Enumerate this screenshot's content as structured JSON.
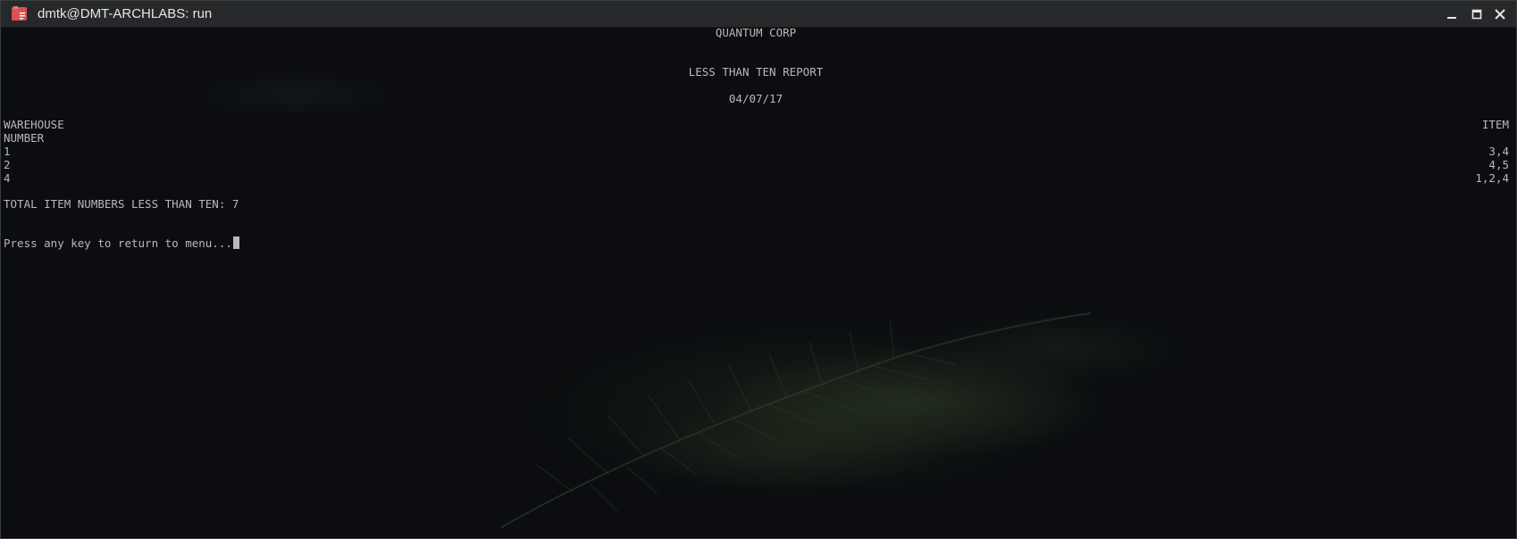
{
  "window": {
    "title": "dmtk@DMT-ARCHLABS: run",
    "controls": {
      "minimize": "minimize-icon",
      "maximize": "maximize-icon",
      "close": "close-icon"
    }
  },
  "report": {
    "company": "QUANTUM CORP",
    "title": "LESS THAN TEN REPORT",
    "date": "04/07/17",
    "header_left_1": "WAREHOUSE",
    "header_left_2": "NUMBER",
    "header_right": "ITEM",
    "rows": [
      {
        "warehouse": "1",
        "items": "3,4"
      },
      {
        "warehouse": "2",
        "items": "4,5"
      },
      {
        "warehouse": "4",
        "items": "1,2,4"
      }
    ],
    "total_line": "TOTAL ITEM NUMBERS LESS THAN TEN: 7",
    "prompt": "Press any key to return to menu..."
  },
  "colors": {
    "titlebar_bg": "#26282a",
    "terminal_bg": "#0b0d10",
    "terminal_text": "#b9b9b9",
    "icon_red": "#d9534f"
  }
}
